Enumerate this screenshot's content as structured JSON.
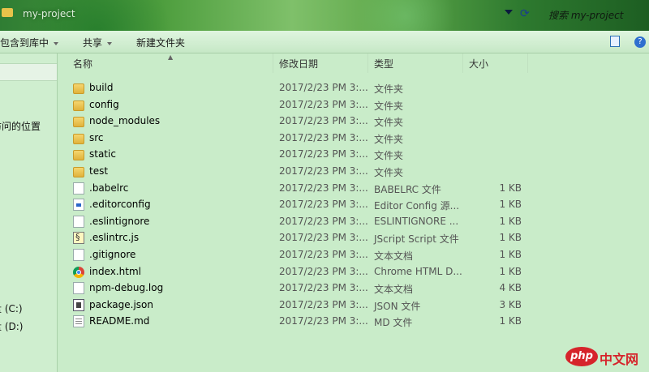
{
  "titlebar": {
    "path": "my-project",
    "search_placeholder": "搜索 my-project"
  },
  "toolbar": {
    "include_in_library": "包含到库中",
    "share": "共享",
    "new_folder": "新建文件夹"
  },
  "nav": {
    "items": [
      {
        "label": "访问的位置"
      },
      {
        "label": "盘 (C:)"
      },
      {
        "label": "盘 (D:)"
      }
    ]
  },
  "columns": {
    "name": "名称",
    "modified": "修改日期",
    "type": "类型",
    "size": "大小"
  },
  "files": [
    {
      "name": "build",
      "date": "2017/2/23 PM 3:...",
      "type": "文件夹",
      "size": "",
      "icon": "folder-icon"
    },
    {
      "name": "config",
      "date": "2017/2/23 PM 3:...",
      "type": "文件夹",
      "size": "",
      "icon": "folder-icon"
    },
    {
      "name": "node_modules",
      "date": "2017/2/23 PM 3:...",
      "type": "文件夹",
      "size": "",
      "icon": "folder-icon"
    },
    {
      "name": "src",
      "date": "2017/2/23 PM 3:...",
      "type": "文件夹",
      "size": "",
      "icon": "folder-icon"
    },
    {
      "name": "static",
      "date": "2017/2/23 PM 3:...",
      "type": "文件夹",
      "size": "",
      "icon": "folder-icon"
    },
    {
      "name": "test",
      "date": "2017/2/23 PM 3:...",
      "type": "文件夹",
      "size": "",
      "icon": "folder-icon"
    },
    {
      "name": ".babelrc",
      "date": "2017/2/23 PM 3:...",
      "type": "BABELRC 文件",
      "size": "1 KB",
      "icon": "file-icon"
    },
    {
      "name": ".editorconfig",
      "date": "2017/2/23 PM 3:...",
      "type": "Editor Config 源...",
      "size": "1 KB",
      "icon": "config-icon"
    },
    {
      "name": ".eslintignore",
      "date": "2017/2/23 PM 3:...",
      "type": "ESLINTIGNORE ...",
      "size": "1 KB",
      "icon": "file-icon"
    },
    {
      "name": ".eslintrc.js",
      "date": "2017/2/23 PM 3:...",
      "type": "JScript Script 文件",
      "size": "1 KB",
      "icon": "script-icon"
    },
    {
      "name": ".gitignore",
      "date": "2017/2/23 PM 3:...",
      "type": "文本文档",
      "size": "1 KB",
      "icon": "file-icon"
    },
    {
      "name": "index.html",
      "date": "2017/2/23 PM 3:...",
      "type": "Chrome HTML D...",
      "size": "1 KB",
      "icon": "chrome-icon"
    },
    {
      "name": "npm-debug.log",
      "date": "2017/2/23 PM 3:...",
      "type": "文本文档",
      "size": "4 KB",
      "icon": "file-icon"
    },
    {
      "name": "package.json",
      "date": "2017/2/23 PM 3:...",
      "type": "JSON 文件",
      "size": "3 KB",
      "icon": "json-icon"
    },
    {
      "name": "README.md",
      "date": "2017/2/23 PM 3:...",
      "type": "MD 文件",
      "size": "1 KB",
      "icon": "text-icon"
    }
  ],
  "watermark": {
    "badge": "php",
    "text": "中文网"
  }
}
